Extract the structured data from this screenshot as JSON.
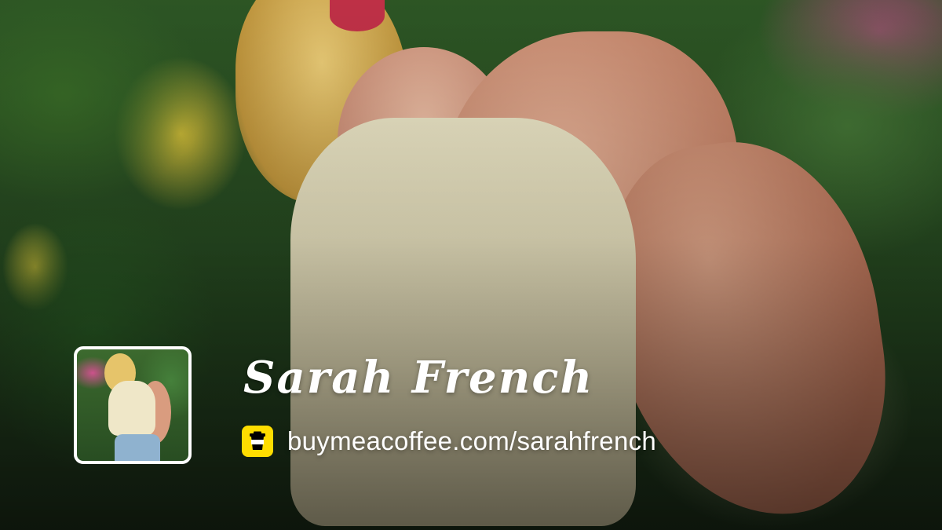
{
  "profile": {
    "name": "Sarah French",
    "url": "buymeacoffee.com/sarahfrench"
  },
  "icons": {
    "link_icon": "coffee-cup-icon"
  },
  "colors": {
    "badge_bg": "#FFDD00",
    "text": "#FFFFFF",
    "avatar_border": "#FFFFFF"
  }
}
